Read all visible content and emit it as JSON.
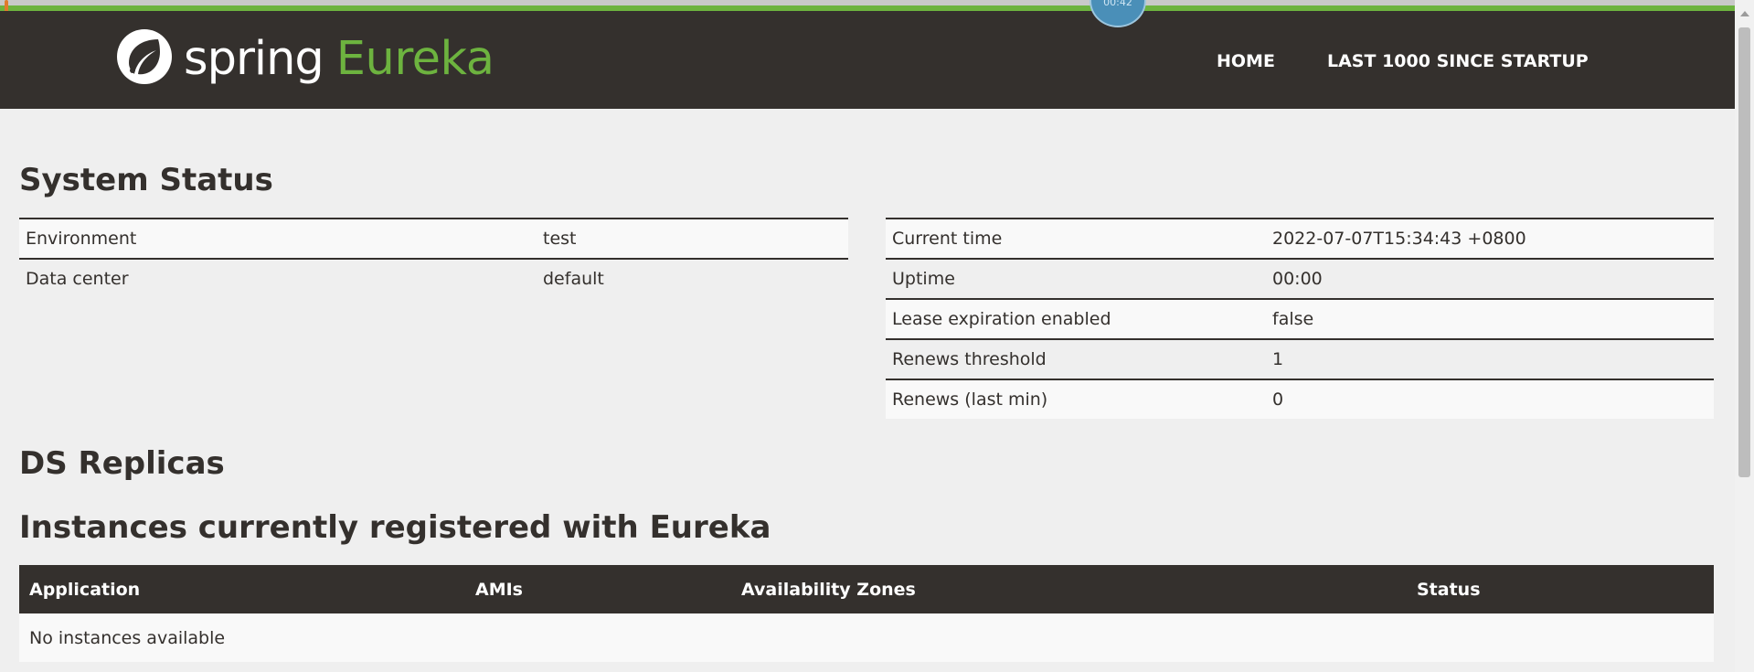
{
  "app": {
    "badge_text": "00:42"
  },
  "nav": {
    "brand_spring": "spring",
    "brand_eureka": "Eureka",
    "home": "HOME",
    "last_1000": "LAST 1000 SINCE STARTUP"
  },
  "system_status": {
    "title": "System Status",
    "left": [
      {
        "label": "Environment",
        "value": "test"
      },
      {
        "label": "Data center",
        "value": "default"
      }
    ],
    "right": [
      {
        "label": "Current time",
        "value": "2022-07-07T15:34:43 +0800"
      },
      {
        "label": "Uptime",
        "value": "00:00"
      },
      {
        "label": "Lease expiration enabled",
        "value": "false"
      },
      {
        "label": "Renews threshold",
        "value": "1"
      },
      {
        "label": "Renews (last min)",
        "value": "0"
      }
    ]
  },
  "ds_replicas": {
    "title": "DS Replicas"
  },
  "instances": {
    "title": "Instances currently registered with Eureka",
    "columns": [
      "Application",
      "AMIs",
      "Availability Zones",
      "Status"
    ],
    "empty_message": "No instances available"
  },
  "colors": {
    "brand_green": "#6db33f",
    "nav_dark": "#34302d",
    "background": "#efefef"
  }
}
